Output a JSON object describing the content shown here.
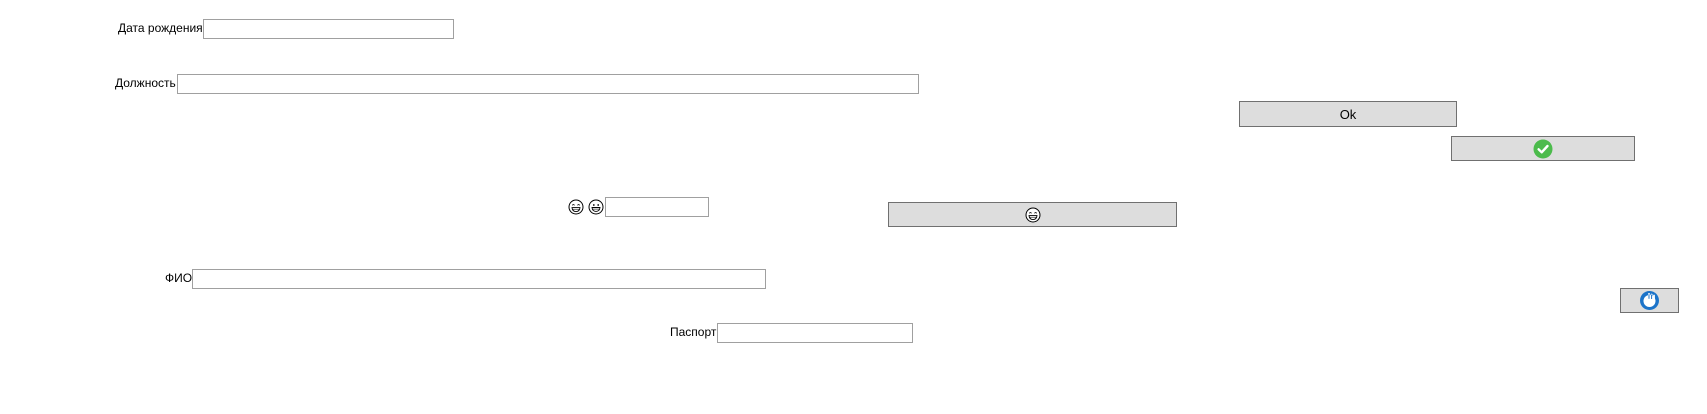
{
  "form": {
    "birth_date": {
      "label": "Дата рождения",
      "value": ""
    },
    "position": {
      "label": "Должность",
      "value": ""
    },
    "fio": {
      "label": "ФИО",
      "value": ""
    },
    "passport": {
      "label": "Паспорт",
      "value": ""
    },
    "emoji_field": {
      "value": ""
    }
  },
  "buttons": {
    "ok": {
      "label": "Ok"
    },
    "confirm": {
      "icon": "green-check-circle-icon"
    },
    "emoji": {
      "icon": "grinning-face-icon"
    },
    "round": {
      "icon": "blue-circular-hand-icon"
    }
  },
  "icons": {
    "emoji_1": "laughing-face-icon",
    "emoji_2": "grinning-face-icon"
  },
  "colors": {
    "button_bg": "#dddddd",
    "button_border": "#707070",
    "field_border": "#a0a0a0",
    "check_green": "#4cbb4c",
    "round_blue": "#1b73c9"
  }
}
